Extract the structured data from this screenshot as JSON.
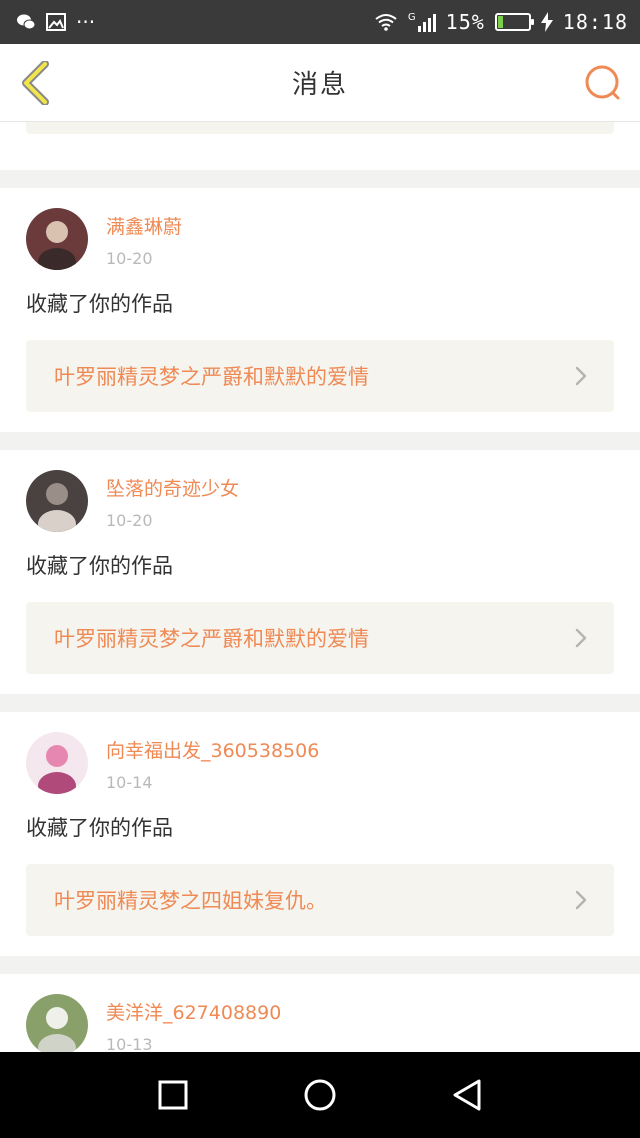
{
  "status_bar": {
    "left_icons": [
      "wechat-icon",
      "image-icon",
      "more-icon"
    ],
    "network_label": "G",
    "battery_percent_text": "15%",
    "battery_level": 0.15,
    "time": "18:18"
  },
  "header": {
    "title": "消息",
    "back_icon": "chevron-left-icon",
    "search_icon": "search-icon"
  },
  "feed": {
    "items": [
      {
        "partial": true,
        "work_title": ""
      },
      {
        "user": "满鑫琳蔚",
        "date": "10-20",
        "action": "收藏了你的作品",
        "work_title": "叶罗丽精灵梦之严爵和默默的爱情",
        "avatar_colors": [
          "#6b3b3b",
          "#d9c2b0",
          "#3b2a2a"
        ]
      },
      {
        "user": "坠落的奇迹少女",
        "date": "10-20",
        "action": "收藏了你的作品",
        "work_title": "叶罗丽精灵梦之严爵和默默的爱情",
        "avatar_colors": [
          "#4a4240",
          "#9a8f88",
          "#d8d0c9"
        ]
      },
      {
        "user": "向幸福出发_360538506",
        "date": "10-14",
        "action": "收藏了你的作品",
        "work_title": "叶罗丽精灵梦之四姐妹复仇。",
        "avatar_colors": [
          "#f4e7ee",
          "#e587b0",
          "#b04a7a"
        ]
      },
      {
        "user": "美洋洋_627408890",
        "date": "10-13",
        "action": "",
        "work_title": "",
        "avatar_colors": [
          "#8aa06a",
          "#f0f0ea",
          "#cfd3c8"
        ]
      }
    ]
  },
  "nav_bar": {
    "buttons": [
      "recent-apps-icon",
      "home-icon",
      "back-triangle-icon"
    ]
  },
  "colors": {
    "accent": "#ef8a55",
    "header_bg": "#ffffff",
    "statusbar_bg": "#3a3a3a",
    "card_bg": "#ffffff",
    "work_bg": "#f5f4ee",
    "page_bg": "#f2f2f0"
  }
}
